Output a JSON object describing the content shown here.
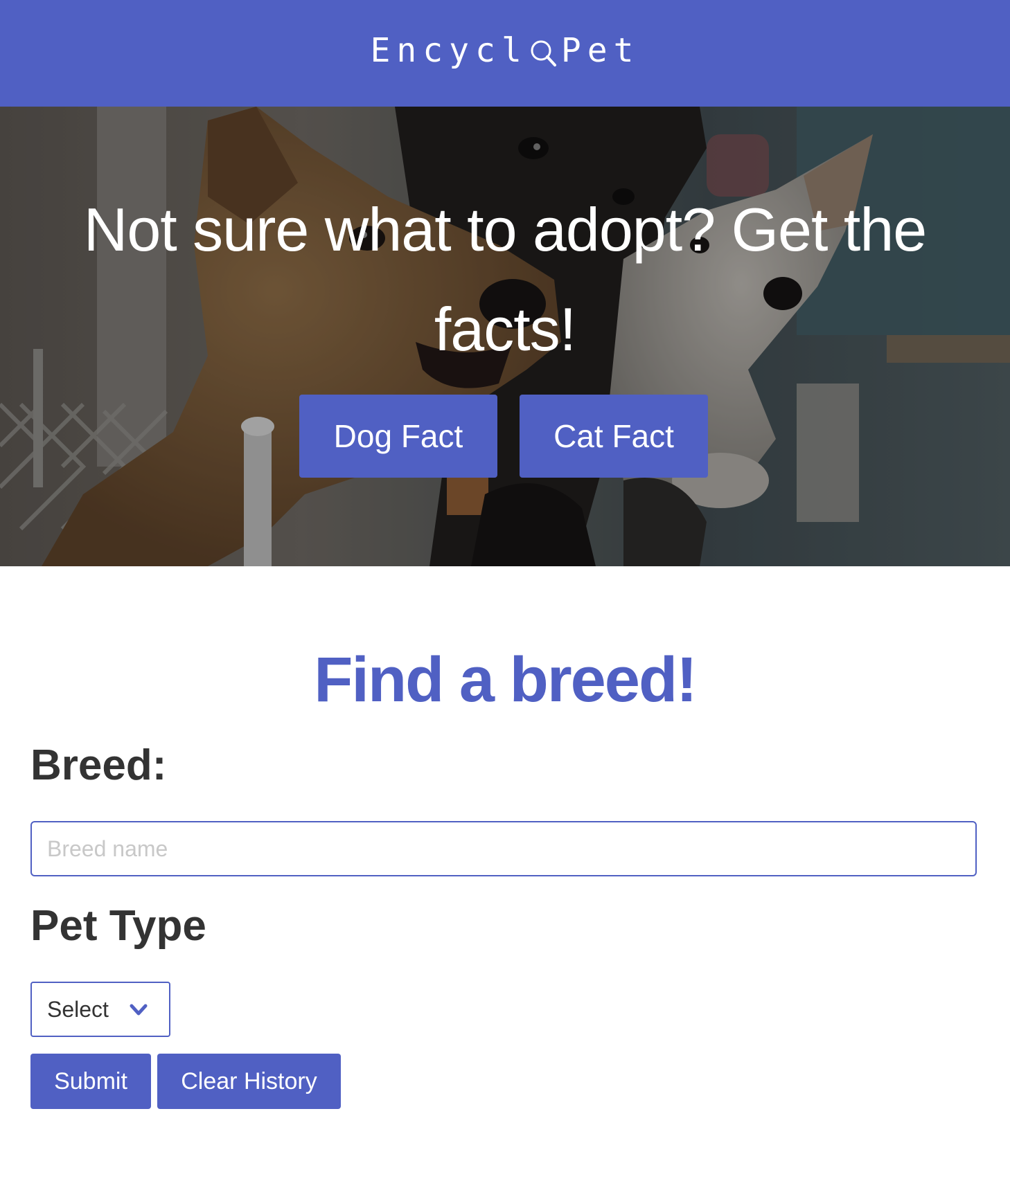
{
  "header": {
    "logo_before": "Encycl",
    "logo_after": "Pet"
  },
  "hero": {
    "headline": "Not sure what to adopt? Get the facts!",
    "dog_fact_label": "Dog Fact",
    "cat_fact_label": "Cat Fact"
  },
  "search": {
    "title": "Find a breed!",
    "breed_label": "Breed:",
    "breed_placeholder": "Breed name",
    "breed_value": "",
    "pet_type_label": "Pet Type",
    "pet_type_selected": "Select",
    "submit_label": "Submit",
    "clear_label": "Clear History"
  },
  "colors": {
    "brand": "#5060c3",
    "heading_text": "#333333"
  }
}
